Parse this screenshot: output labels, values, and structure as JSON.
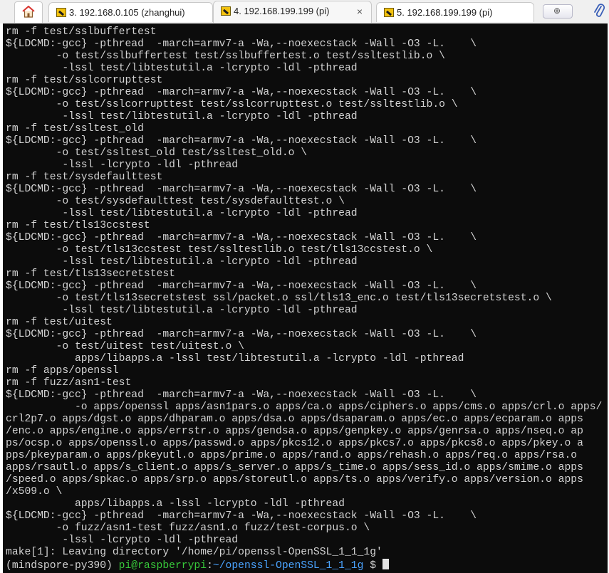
{
  "tabs": [
    {
      "label": "3. 192.168.0.105 (zhanghui)"
    },
    {
      "label": "4. 192.168.199.199 (pi)",
      "close": "×"
    },
    {
      "label": "5. 192.168.199.199 (pi)"
    }
  ],
  "terminal": {
    "output": "rm -f test/sslbuffertest\n${LDCMD:-gcc} -pthread  -march=armv7-a -Wa,--noexecstack -Wall -O3 -L.    \\\n        -o test/sslbuffertest test/sslbuffertest.o test/ssltestlib.o \\\n         -lssl test/libtestutil.a -lcrypto -ldl -pthread\nrm -f test/sslcorrupttest\n${LDCMD:-gcc} -pthread  -march=armv7-a -Wa,--noexecstack -Wall -O3 -L.    \\\n        -o test/sslcorrupttest test/sslcorrupttest.o test/ssltestlib.o \\\n         -lssl test/libtestutil.a -lcrypto -ldl -pthread\nrm -f test/ssltest_old\n${LDCMD:-gcc} -pthread  -march=armv7-a -Wa,--noexecstack -Wall -O3 -L.    \\\n        -o test/ssltest_old test/ssltest_old.o \\\n         -lssl -lcrypto -ldl -pthread\nrm -f test/sysdefaulttest\n${LDCMD:-gcc} -pthread  -march=armv7-a -Wa,--noexecstack -Wall -O3 -L.    \\\n        -o test/sysdefaulttest test/sysdefaulttest.o \\\n         -lssl test/libtestutil.a -lcrypto -ldl -pthread\nrm -f test/tls13ccstest\n${LDCMD:-gcc} -pthread  -march=armv7-a -Wa,--noexecstack -Wall -O3 -L.    \\\n        -o test/tls13ccstest test/ssltestlib.o test/tls13ccstest.o \\\n         -lssl test/libtestutil.a -lcrypto -ldl -pthread\nrm -f test/tls13secretstest\n${LDCMD:-gcc} -pthread  -march=armv7-a -Wa,--noexecstack -Wall -O3 -L.    \\\n        -o test/tls13secretstest ssl/packet.o ssl/tls13_enc.o test/tls13secretstest.o \\\n         -lssl test/libtestutil.a -lcrypto -ldl -pthread\nrm -f test/uitest\n${LDCMD:-gcc} -pthread  -march=armv7-a -Wa,--noexecstack -Wall -O3 -L.    \\\n        -o test/uitest test/uitest.o \\\n           apps/libapps.a -lssl test/libtestutil.a -lcrypto -ldl -pthread\nrm -f apps/openssl\nrm -f fuzz/asn1-test\n${LDCMD:-gcc} -pthread  -march=armv7-a -Wa,--noexecstack -Wall -O3 -L.    \\\n           -o apps/openssl apps/asn1pars.o apps/ca.o apps/ciphers.o apps/cms.o apps/crl.o apps/\ncrl2p7.o apps/dgst.o apps/dhparam.o apps/dsa.o apps/dsaparam.o apps/ec.o apps/ecparam.o apps\n/enc.o apps/engine.o apps/errstr.o apps/gendsa.o apps/genpkey.o apps/genrsa.o apps/nseq.o ap\nps/ocsp.o apps/openssl.o apps/passwd.o apps/pkcs12.o apps/pkcs7.o apps/pkcs8.o apps/pkey.o a\npps/pkeyparam.o apps/pkeyutl.o apps/prime.o apps/rand.o apps/rehash.o apps/req.o apps/rsa.o\napps/rsautl.o apps/s_client.o apps/s_server.o apps/s_time.o apps/sess_id.o apps/smime.o apps\n/speed.o apps/spkac.o apps/srp.o apps/storeutl.o apps/ts.o apps/verify.o apps/version.o apps\n/x509.o \\\n           apps/libapps.a -lssl -lcrypto -ldl -pthread\n${LDCMD:-gcc} -pthread  -march=armv7-a -Wa,--noexecstack -Wall -O3 -L.    \\\n        -o fuzz/asn1-test fuzz/asn1.o fuzz/test-corpus.o \\\n         -lssl -lcrypto -ldl -pthread\nmake[1]: Leaving directory '/home/pi/openssl-OpenSSL_1_1_1g'",
    "prompt": {
      "env": "(mindspore-py390) ",
      "user_host": "pi@raspberrypi",
      "sep": ":",
      "path": "~/openssl-OpenSSL_1_1_1g",
      "symbol": " $ "
    }
  },
  "colors": {
    "terminal_bg": "#0c0c0c",
    "terminal_fg": "#d3d3d3",
    "prompt_user": "#37c83a",
    "prompt_path": "#4aa3ff"
  },
  "icons": [
    "home-icon",
    "terminal-tab-icon",
    "close-icon",
    "new-tab-icon",
    "paperclip-icon"
  ]
}
